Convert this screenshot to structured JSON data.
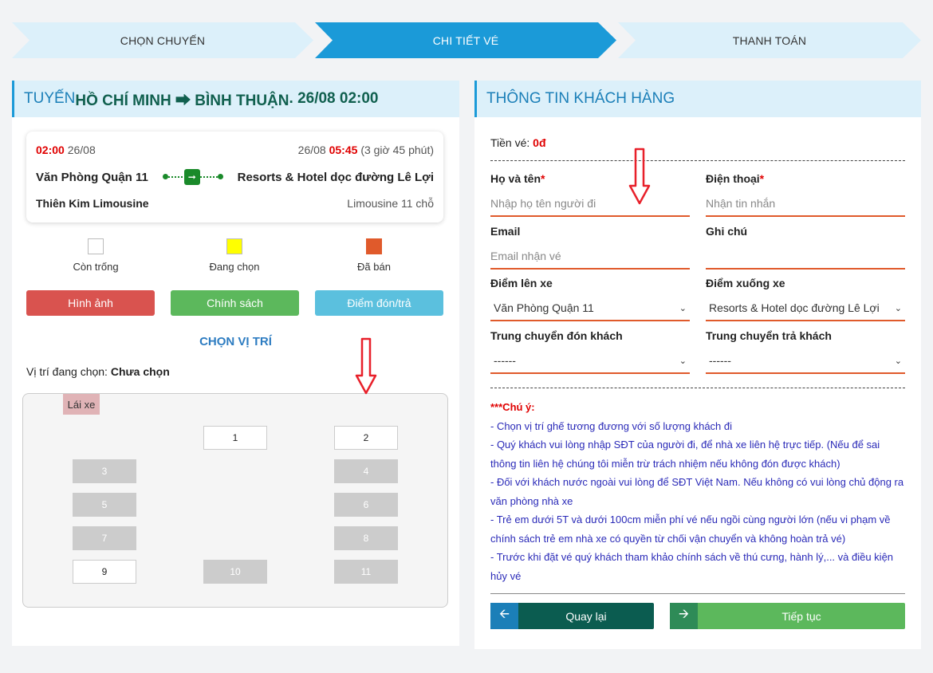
{
  "steps": [
    "CHỌN CHUYẾN",
    "CHI TIẾT VÉ",
    "THANH TOÁN"
  ],
  "trip_header": {
    "prefix": "TUYẾN ",
    "route": "HỒ CHÍ MINH ⮕ BÌNH THUẬN",
    "datetime": ". 26/08 02:00"
  },
  "trip": {
    "depart_time": "02:00",
    "depart_date": "26/08",
    "arrive_date": "26/08",
    "arrive_time": "05:45",
    "duration": "(3 giờ 45 phút)",
    "from": "Văn Phòng Quận 11",
    "to": "Resorts & Hotel dọc đường Lê Lợi",
    "operator": "Thiên Kim Limousine",
    "vehicle": "Limousine 11 chỗ"
  },
  "legend": [
    {
      "label": "Còn trống",
      "color": "#ffffff"
    },
    {
      "label": "Đang chọn",
      "color": "#ffff00"
    },
    {
      "label": "Đã bán",
      "color": "#e05a2b"
    }
  ],
  "buttons": {
    "images": "Hình ảnh",
    "policy": "Chính sách",
    "pickup": "Điểm đón/trả"
  },
  "choose_title": "CHỌN VỊ TRÍ",
  "current_position": {
    "label": "Vị trí đang chọn: ",
    "value": "Chưa chọn"
  },
  "seatmap": {
    "driver": "Lái xe",
    "seats": [
      {
        "no": "1",
        "status": "free"
      },
      {
        "no": "2",
        "status": "free"
      },
      {
        "no": "3",
        "status": "sold"
      },
      {
        "no": "4",
        "status": "sold"
      },
      {
        "no": "5",
        "status": "sold"
      },
      {
        "no": "6",
        "status": "sold"
      },
      {
        "no": "7",
        "status": "sold"
      },
      {
        "no": "8",
        "status": "sold"
      },
      {
        "no": "9",
        "status": "free"
      },
      {
        "no": "10",
        "status": "sold"
      },
      {
        "no": "11",
        "status": "sold"
      }
    ]
  },
  "customer": {
    "title": "THÔNG TIN KHÁCH HÀNG",
    "price_label": "Tiền vé: ",
    "price_value": "0đ",
    "name_label": "Họ và tên",
    "name_placeholder": "Nhập họ tên người đi",
    "phone_label": "Điện thoại",
    "phone_placeholder": "Nhận tin nhắn",
    "email_label": "Email",
    "email_placeholder": "Email nhận vé",
    "note_label": "Ghi chú",
    "note_value": "",
    "pickup_label": "Điểm lên xe",
    "pickup_value": "Văn Phòng Quận 11",
    "dropoff_label": "Điểm xuống xe",
    "dropoff_value": "Resorts & Hotel dọc đường Lê Lợi",
    "transfer_pick_label": "Trung chuyển đón khách",
    "transfer_pick_value": "------",
    "transfer_drop_label": "Trung chuyển trả khách",
    "transfer_drop_value": "------",
    "required_mark": "*"
  },
  "notes": {
    "title": "***Chú ý:",
    "items": [
      "- Chọn vị trí ghế tương đương với số lượng khách đi",
      "- Quý khách vui lòng nhập SĐT của người đi, để nhà xe liên hệ trực tiếp. (Nếu để sai thông tin liên hệ chúng tôi miễn trừ trách nhiệm nếu không đón được khách)",
      "- Đối với khách nước ngoài vui lòng để SĐT Việt Nam. Nếu không có vui lòng chủ động ra văn phòng nhà xe",
      "- Trẻ em dưới 5T và dưới 100cm miễn phí vé nếu ngồi cùng người lớn (nếu vi phạm về chính sách trẻ em nhà xe có quyền từ chối vận chuyển và không hoàn trả vé)",
      "- Trước khi đặt vé quý khách tham khảo chính sách về thú cưng, hành lý,... và điều kiện hủy vé"
    ]
  },
  "nav": {
    "back": "Quay lại",
    "next": "Tiếp tục"
  },
  "colors": {
    "accent": "#1b9ad8",
    "red": "#d9534f",
    "green": "#5cb85c",
    "info": "#5bc0de",
    "dark_teal": "#0b5c50",
    "underline": "#e05a2b"
  }
}
